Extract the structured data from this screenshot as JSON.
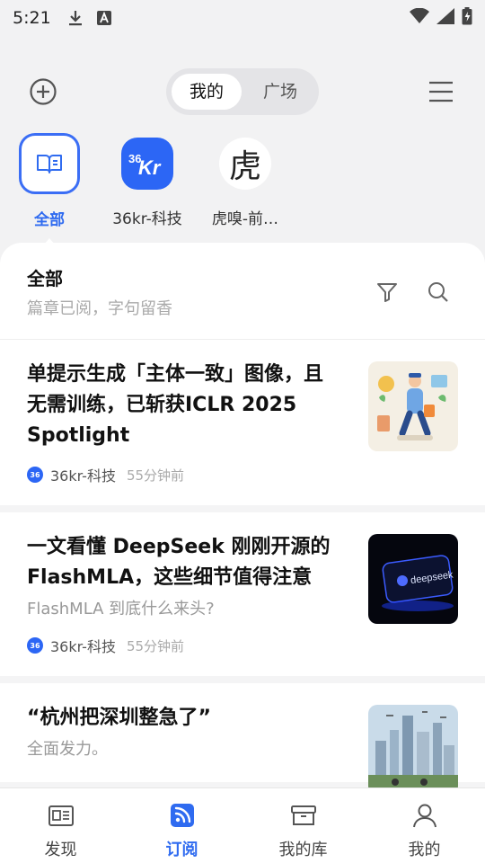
{
  "status_bar": {
    "time": "5:21",
    "icons": [
      "download-icon",
      "a-notification-icon",
      "wifi-icon",
      "signal-icon",
      "battery-icon"
    ]
  },
  "header": {
    "add_icon": "plus-circle-icon",
    "segments": [
      "我的",
      "广场"
    ],
    "active_segment": "我的",
    "menu_icon": "hamburger-menu-icon"
  },
  "sources": [
    {
      "label": "全部",
      "icon": "book-icon",
      "active": true
    },
    {
      "label": "36kr-科技",
      "logo_text": "36Kr",
      "active": false
    },
    {
      "label": "虎嗅-前…",
      "logo_text": "虎",
      "active": false
    }
  ],
  "panel": {
    "title": "全部",
    "subtitle": "篇章已阅，字句留香",
    "filter_icon": "filter-icon",
    "search_icon": "search-icon"
  },
  "articles": [
    {
      "title": "单提示生成「主体一致」图像，且无需训练，已斩获ICLR 2025 Spotlight",
      "summary": "",
      "source": "36kr-科技",
      "time": "55分钟前",
      "thumb": "illustration-walking-man"
    },
    {
      "title": "一文看懂 DeepSeek 刚刚开源的 FlashMLA，这些细节值得注意",
      "summary": "FlashMLA 到底什么来头?",
      "source": "36kr-科技",
      "time": "55分钟前",
      "thumb": "deepseek-card",
      "thumb_text": "deepseek"
    },
    {
      "title": "“杭州把深圳整急了”",
      "summary": "全面发力。",
      "source": "",
      "time": "",
      "thumb": "city-skyline"
    }
  ],
  "bottom_nav": [
    {
      "label": "发现",
      "icon": "newspaper-icon",
      "active": false
    },
    {
      "label": "订阅",
      "icon": "rss-icon",
      "active": true
    },
    {
      "label": "我的库",
      "icon": "archive-box-icon",
      "active": false
    },
    {
      "label": "我的",
      "icon": "user-icon",
      "active": false
    }
  ],
  "colors": {
    "accent": "#2f6bf0",
    "brand_36kr": "#2c66f5"
  }
}
